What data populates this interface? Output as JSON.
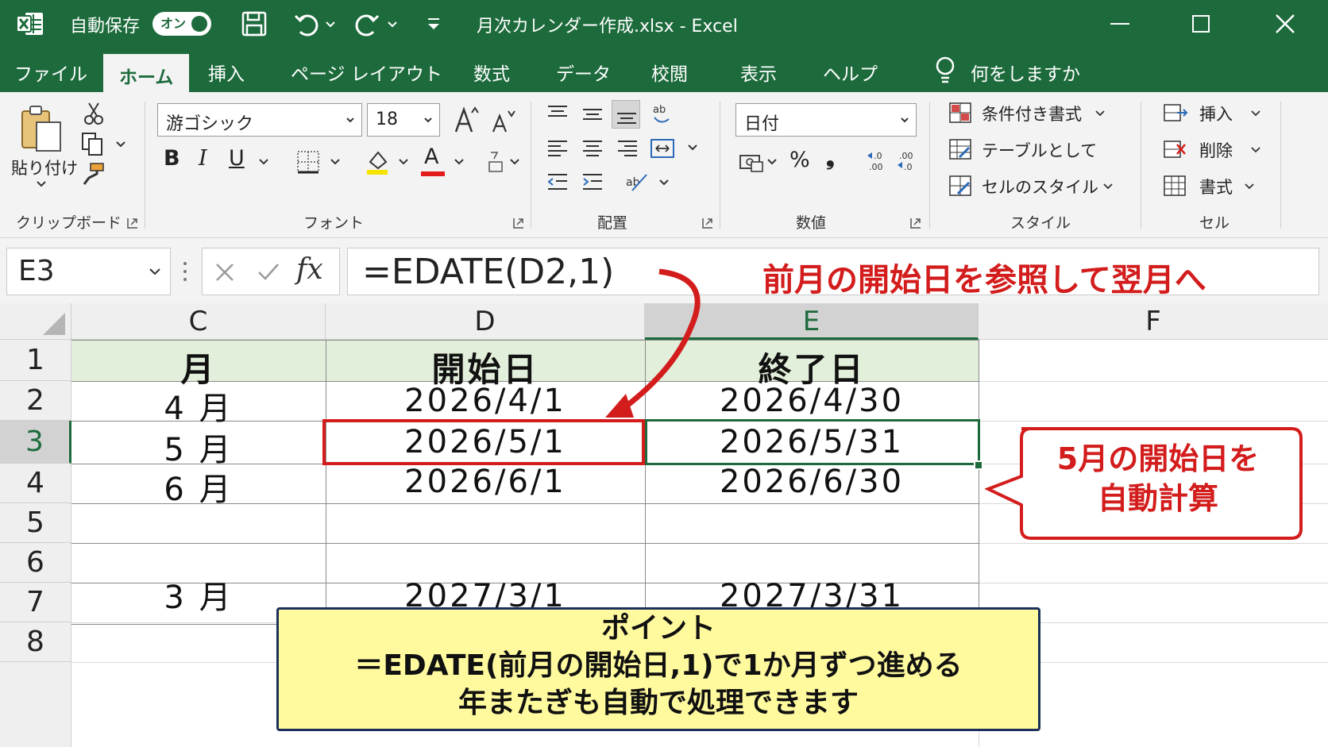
{
  "titlebar": {
    "autosave_label": "自動保存",
    "autosave_state": "オン",
    "document_title": "月次カレンダー作成.xlsx  -  Excel"
  },
  "tabs": [
    "ファイル",
    "ホーム",
    "挿入",
    "ページ レイアウト",
    "数式",
    "データ",
    "校閲",
    "表示",
    "ヘルプ"
  ],
  "active_tab": "ホーム",
  "tell_me": "何をしますか",
  "ribbon": {
    "clipboard": {
      "paste_label": "貼り付け",
      "group_label": "クリップボード"
    },
    "font": {
      "font_name": "游ゴシック",
      "font_size": "18",
      "bold": "B",
      "italic": "I",
      "underline": "U",
      "font_color_letter": "A",
      "group_label": "フォント"
    },
    "alignment": {
      "group_label": "配置"
    },
    "number": {
      "format": "日付",
      "percent": "%",
      "comma": "❟",
      "group_label": "数値"
    },
    "styles": {
      "conditional": "条件付き書式",
      "as_table": "テーブルとして",
      "cell_styles": "セルのスタイル",
      "group_label": "スタイル"
    },
    "cells": {
      "insert": "挿入",
      "delete": "削除",
      "format": "書式",
      "group_label": "セル"
    }
  },
  "formula_bar": {
    "name_box": "E3",
    "fx": "fx",
    "formula": "=EDATE(D2,1)"
  },
  "annotations": {
    "top_callout": "前月の開始日を参照して翌月へ",
    "bubble_line1": "5月の開始日を",
    "bubble_line2": "自動計算",
    "point_title": "ポイント",
    "point_line1": "＝EDATE(前月の開始日,1)で1か月ずつ進める",
    "point_line2": "年またぎも自動で処理できます"
  },
  "sheet": {
    "columns": [
      "C",
      "D",
      "E",
      "F"
    ],
    "rows": [
      "1",
      "2",
      "3",
      "4",
      "5",
      "6",
      "7",
      "8"
    ],
    "header": [
      "月",
      "開始日",
      "終了日"
    ],
    "data": [
      [
        "4 月",
        "2026/4/1",
        "2026/4/30"
      ],
      [
        "5 月",
        "2026/5/1",
        "2026/5/31"
      ],
      [
        "6 月",
        "2026/6/1",
        "2026/6/30"
      ],
      [
        "3 月",
        "2027/3/1",
        "2027/3/31"
      ]
    ]
  },
  "colors": {
    "excel_green": "#1d6b3c",
    "header_fill": "#e2efda",
    "highlight_red": "#d31c1c",
    "note_yellow": "#fffa9e"
  }
}
